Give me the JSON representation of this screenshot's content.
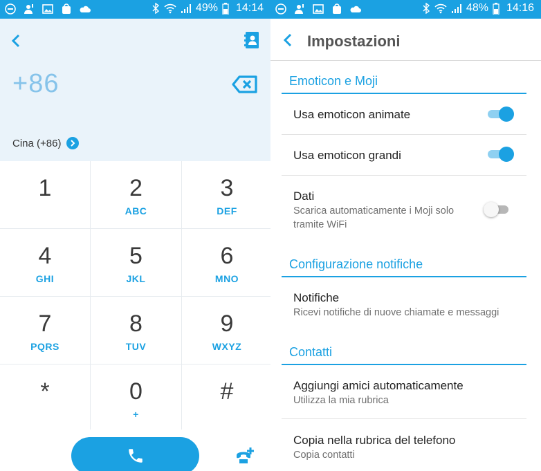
{
  "colors": {
    "accent": "#1ba1e2",
    "dial_bg": "#eaf3fa",
    "number": "#86c3ea"
  },
  "left": {
    "status": {
      "battery": "49%",
      "time": "14:14"
    },
    "dial": {
      "number": "+86",
      "country": "Cina (+86)"
    },
    "keys": [
      {
        "num": "1",
        "letters": ""
      },
      {
        "num": "2",
        "letters": "ABC"
      },
      {
        "num": "3",
        "letters": "DEF"
      },
      {
        "num": "4",
        "letters": "GHI"
      },
      {
        "num": "5",
        "letters": "JKL"
      },
      {
        "num": "6",
        "letters": "MNO"
      },
      {
        "num": "7",
        "letters": "PQRS"
      },
      {
        "num": "8",
        "letters": "TUV"
      },
      {
        "num": "9",
        "letters": "WXYZ"
      },
      {
        "num": "*",
        "letters": ""
      },
      {
        "num": "0",
        "letters": "+"
      },
      {
        "num": "#",
        "letters": ""
      }
    ]
  },
  "right": {
    "status": {
      "battery": "48%",
      "time": "14:16"
    },
    "title": "Impostazioni",
    "sections": {
      "emoticon": "Emoticon e Moji",
      "notifiche": "Configurazione notifiche",
      "contatti": "Contatti"
    },
    "rows": {
      "animate": {
        "title": "Usa emoticon animate",
        "on": true
      },
      "grandi": {
        "title": "Usa emoticon grandi",
        "on": true
      },
      "dati": {
        "title": "Dati",
        "sub": "Scarica automaticamente i Moji solo tramite WiFi",
        "on": false
      },
      "notifiche": {
        "title": "Notifiche",
        "sub": "Ricevi notifiche di nuove chiamate e messaggi"
      },
      "aggiungi": {
        "title": "Aggiungi amici automaticamente",
        "sub": "Utilizza la mia rubrica"
      },
      "copia": {
        "title": "Copia nella rubrica del telefono",
        "sub": "Copia contatti"
      }
    }
  }
}
